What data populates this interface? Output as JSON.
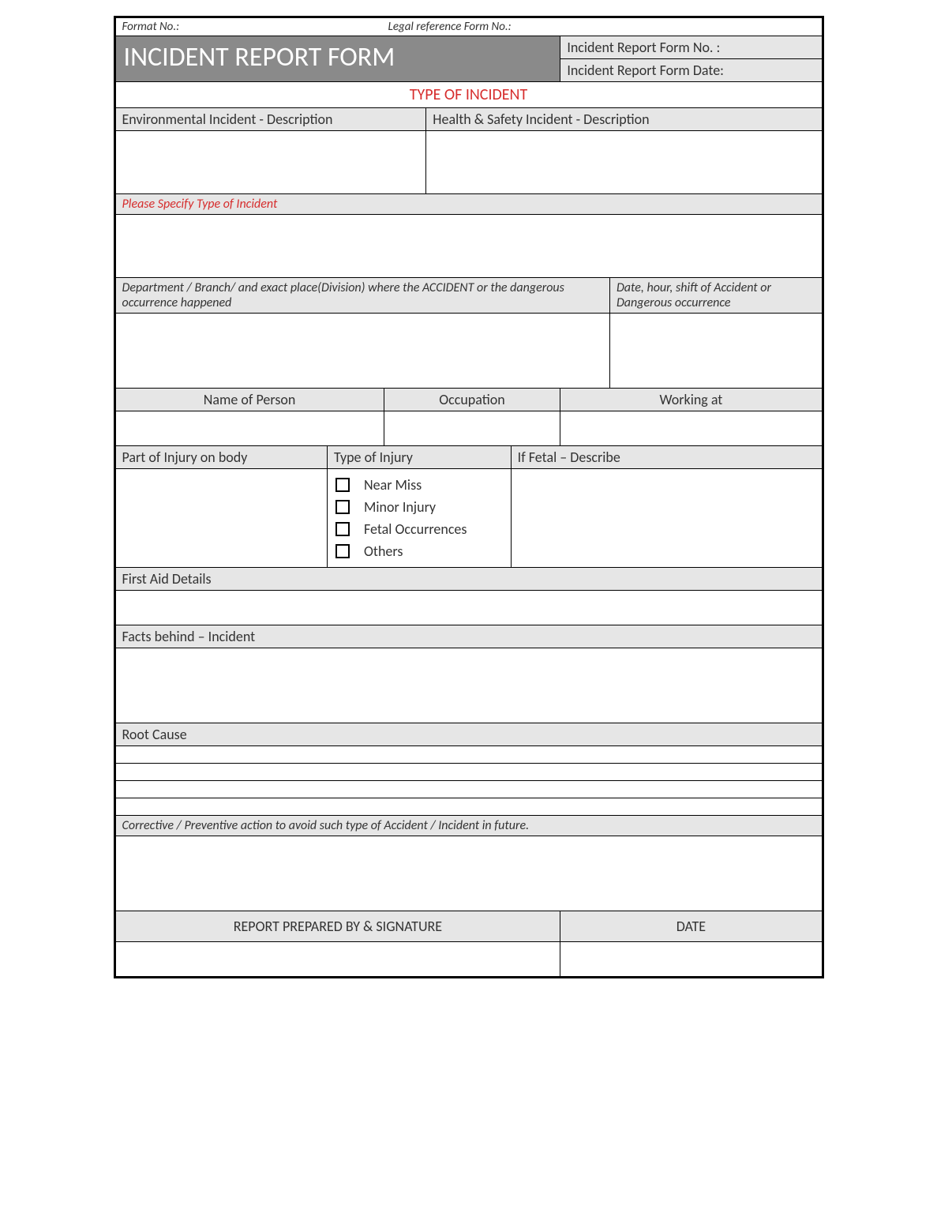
{
  "meta": {
    "format_no_label": "Format No.:",
    "legal_ref_label": "Legal reference Form No.:"
  },
  "title": "INCIDENT REPORT FORM",
  "header_right": {
    "form_no_label": "Incident Report Form No. :",
    "form_date_label": "Incident Report Form Date:"
  },
  "type_of_incident_heading": "TYPE OF INCIDENT",
  "env_incident_label": "Environmental Incident  - Description",
  "hs_incident_label": "Health & Safety Incident - Description",
  "specify_type_label": "Please Specify Type of Incident",
  "dept_label": "Department / Branch/ and exact place(Division) where the ACCIDENT or the dangerous occurrence happened",
  "date_shift_label": "Date, hour, shift  of Accident or Dangerous occurrence",
  "name_label": "Name of Person",
  "occupation_label": "Occupation",
  "working_at_label": "Working at",
  "part_injury_label": "Part of Injury on body",
  "type_injury_label": "Type of Injury",
  "if_fetal_label": "If Fetal – Describe",
  "injury_types": {
    "near_miss": "Near Miss",
    "minor_injury": "Minor Injury",
    "fetal": "Fetal Occurrences",
    "others": "Others"
  },
  "first_aid_label": "First Aid Details",
  "facts_label": "Facts behind – Incident",
  "root_cause_label": "Root Cause",
  "corrective_label": "Corrective / Preventive action to avoid such type of Accident / Incident in future.",
  "prepared_by_label": "REPORT PREPARED BY & SIGNATURE",
  "date_label": "DATE"
}
